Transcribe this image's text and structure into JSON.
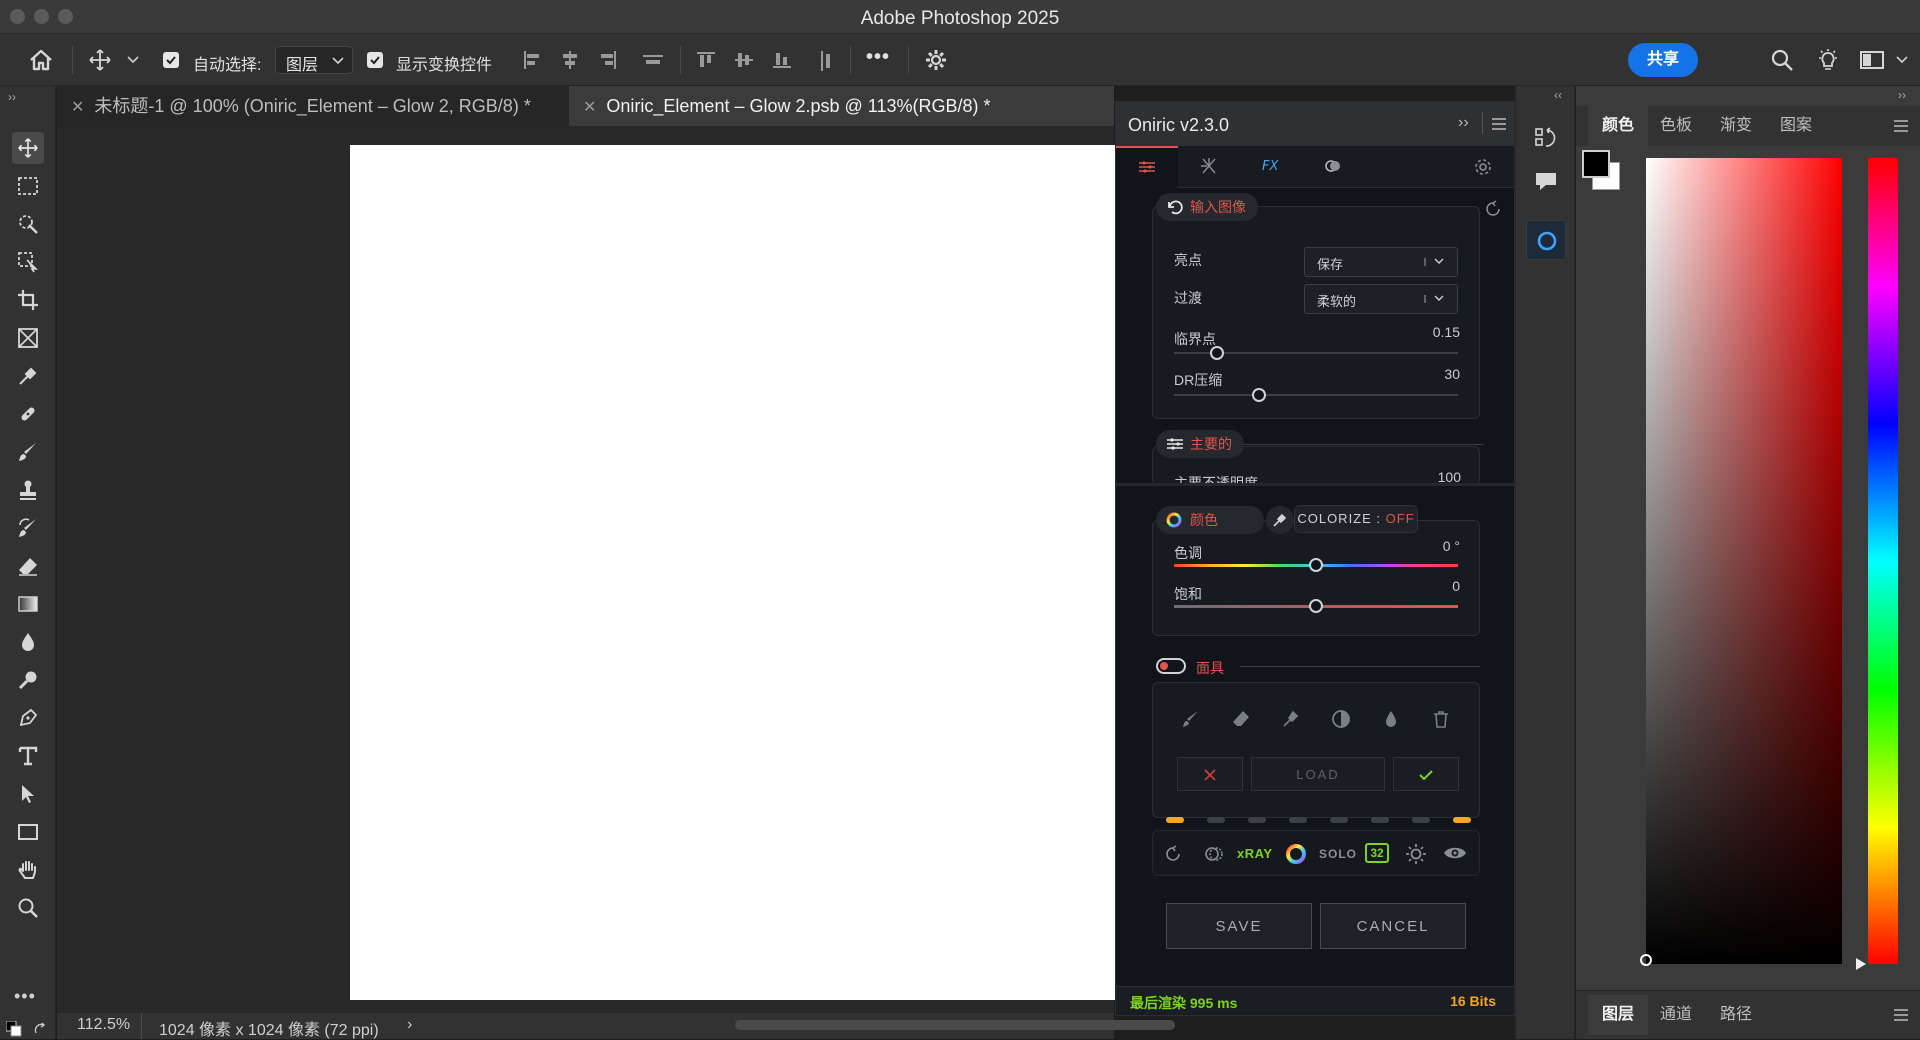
{
  "window": {
    "title": "Adobe Photoshop 2025"
  },
  "options_bar": {
    "auto_select_label": "自动选择:",
    "auto_select_value": "图层",
    "show_transform_label": "显示变换控件",
    "more_label": "•••",
    "share_label": "共享"
  },
  "tabs": [
    {
      "label": "未标题-1 @ 100% (Oniric_Element – Glow 2, RGB/8) *"
    },
    {
      "label": "Oniric_Element – Glow 2.psb @ 113%(RGB/8) *"
    }
  ],
  "status": {
    "zoom": "112.5%",
    "doc_info": "1024 像素 x 1024 像素 (72 ppi)",
    "arrow": "›"
  },
  "plugin": {
    "title": "Oniric v2.3.0",
    "input": {
      "heading": "输入图像",
      "highlight_label": "亮点",
      "highlight_value": "保存",
      "transition_label": "过渡",
      "transition_value": "柔软的",
      "threshold_label": "临界点",
      "threshold_value": "0.15",
      "threshold_level": 0.15,
      "dr_label": "DR压缩",
      "dr_value": "30",
      "dr_level": 0.3
    },
    "main": {
      "heading": "主要的",
      "opacity_label": "主要不透明度",
      "opacity_value": "100"
    },
    "color": {
      "heading": "颜色",
      "colorize_label": "COLORIZE : ",
      "colorize_state": "OFF",
      "hue_label": "色调",
      "hue_value": "0 °",
      "hue_level": 0.5,
      "sat_label": "饱和",
      "sat_value": "0",
      "sat_level": 0.5
    },
    "mask": {
      "heading": "面具",
      "load_label": "LOAD"
    },
    "bottom": {
      "xray_label": "xRAY",
      "solo_label": "SOLO",
      "bits_badge": "32",
      "save_label": "SAVE",
      "cancel_label": "CANCEL",
      "render_label": "最后渲染 995 ms",
      "bits_label": "16 Bits"
    }
  },
  "color_panel": {
    "tabs": [
      "颜色",
      "色板",
      "渐变",
      "图案"
    ],
    "foreground": "#000000",
    "background": "#ffffff"
  },
  "layers_panel": {
    "tabs": [
      "图层",
      "通道",
      "路径"
    ]
  },
  "colors": {
    "accent_red": "#e2544f",
    "accent_blue": "#1473e6",
    "accent_green": "#7ed321",
    "accent_orange": "#f5a623"
  }
}
